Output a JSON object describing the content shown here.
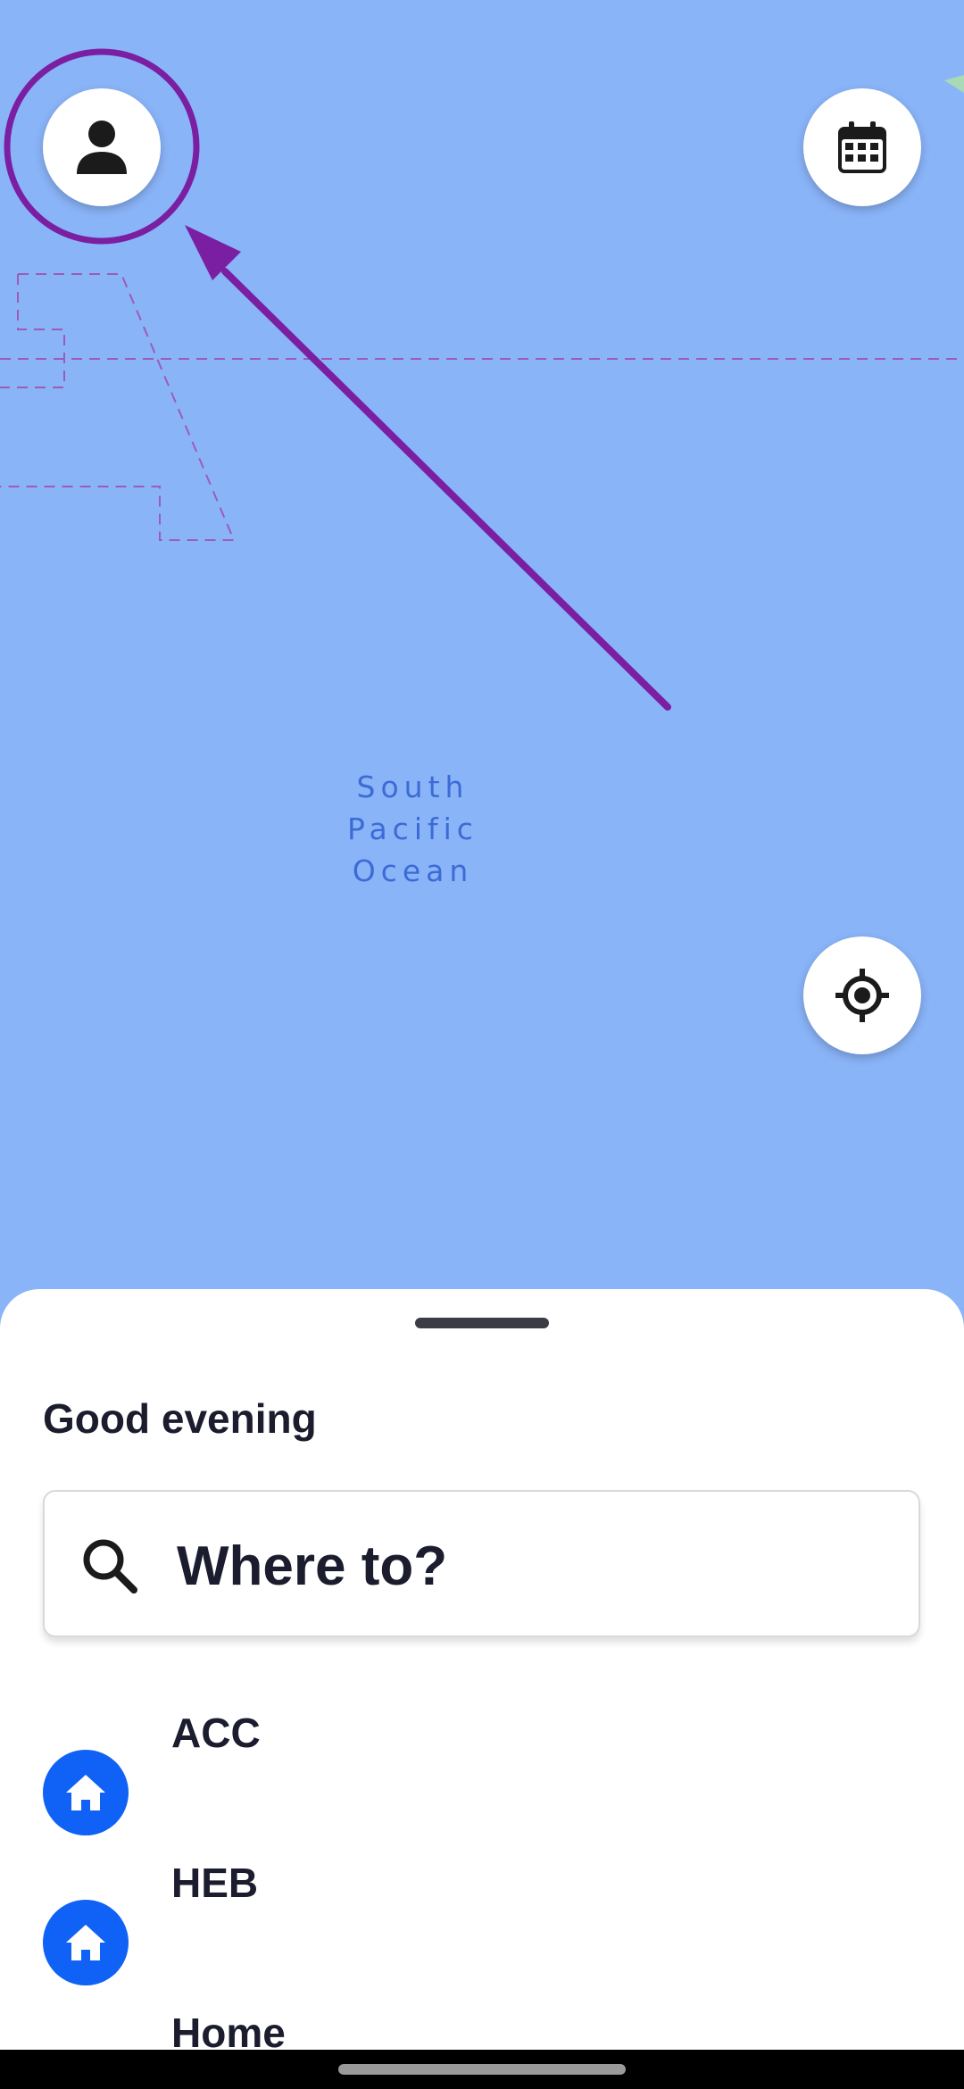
{
  "map": {
    "ocean_label_lines": [
      "South",
      "Pacific",
      "Ocean"
    ],
    "colors": {
      "water": "#8AB4F8",
      "label": "#3D6BD6",
      "border_lines": "#9D5BB6",
      "annotation": "#7B1FA2"
    }
  },
  "controls": {
    "profile": {
      "icon": "person-icon"
    },
    "calendar": {
      "icon": "calendar-icon"
    },
    "locate": {
      "icon": "gps-target-icon"
    }
  },
  "sheet": {
    "greeting": "Good evening",
    "search": {
      "placeholder": "Where to?",
      "icon": "search-icon"
    },
    "places": [
      {
        "label": "ACC",
        "icon": "home-icon"
      },
      {
        "label": "HEB",
        "icon": "home-icon"
      },
      {
        "label": "Home",
        "icon": "home-icon"
      }
    ],
    "accent_color": "#0F62F5"
  }
}
